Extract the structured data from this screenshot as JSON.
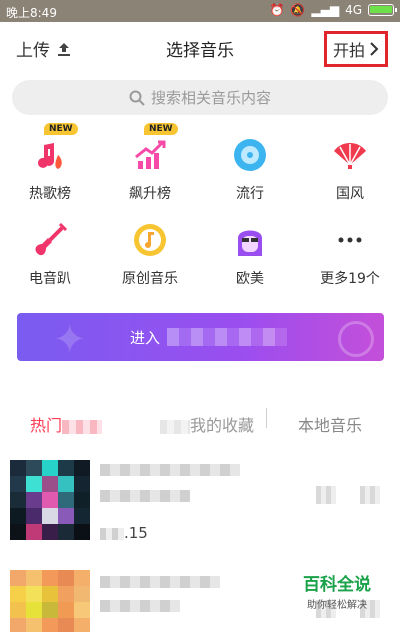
{
  "status_bar": {
    "time": "晚上8:49",
    "network": "4G"
  },
  "header": {
    "upload_label": "上传",
    "title": "选择音乐",
    "start_label": "开拍"
  },
  "search": {
    "placeholder": "搜索相关音乐内容"
  },
  "categories": [
    {
      "label": "热歌榜",
      "badge": "NEW",
      "icon": "hot-chart-icon"
    },
    {
      "label": "飙升榜",
      "badge": "NEW",
      "icon": "rising-chart-icon"
    },
    {
      "label": "流行",
      "icon": "pop-disc-icon"
    },
    {
      "label": "国风",
      "icon": "fan-icon"
    },
    {
      "label": "电音趴",
      "icon": "electric-guitar-icon"
    },
    {
      "label": "原创音乐",
      "icon": "original-music-icon"
    },
    {
      "label": "欧美",
      "icon": "western-avatar-icon"
    },
    {
      "label": "更多19个",
      "icon": "more-dots-icon"
    }
  ],
  "banner": {
    "text": "进入"
  },
  "tabs": {
    "hot": "热门",
    "favorites": "我的收藏",
    "local": "本地音乐"
  },
  "songs": [
    {
      "duration_suffix": ".15"
    },
    {
      "duration_suffix": ""
    }
  ],
  "watermark": {
    "title": "百科全说",
    "subtitle": "助你轻松解决"
  },
  "colors": {
    "accent": "#ff3b55",
    "banner_start": "#7a5cf0",
    "banner_end": "#c44fd9",
    "highlight_box": "#e0262c",
    "watermark": "#1aa24a"
  }
}
